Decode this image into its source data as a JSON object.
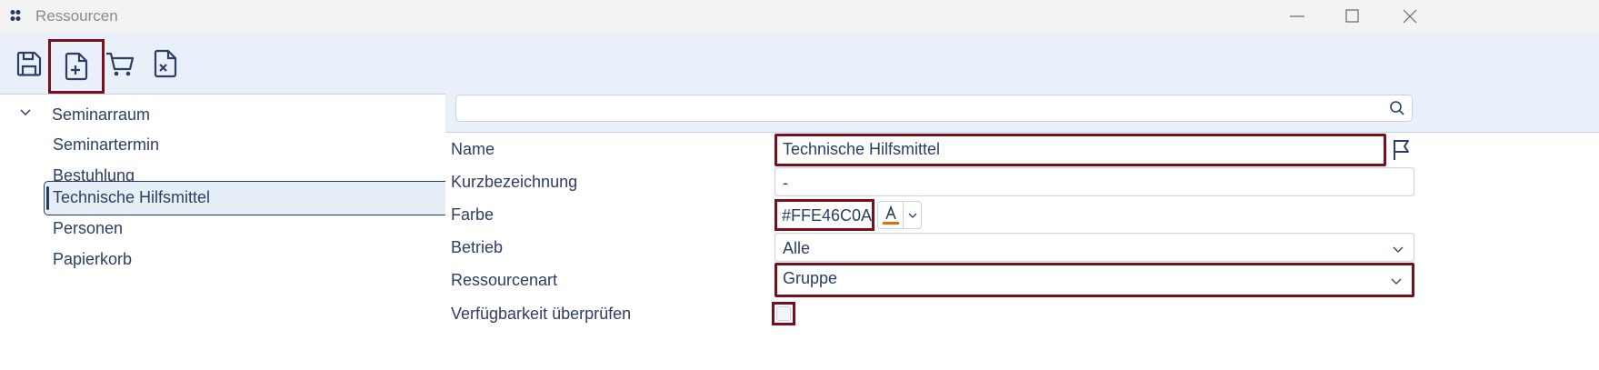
{
  "window": {
    "title": "Ressourcen"
  },
  "toolbar": {
    "items": [
      {
        "name": "save",
        "icon": "save-icon"
      },
      {
        "name": "new",
        "icon": "new-document-icon",
        "highlighted": true
      },
      {
        "name": "cart",
        "icon": "cart-icon"
      },
      {
        "name": "delete",
        "icon": "delete-document-icon"
      }
    ]
  },
  "tree": {
    "items": [
      {
        "label": "Seminarraum",
        "expanded": true
      },
      {
        "label": "Seminartermin"
      },
      {
        "label": "Bestuhlung"
      },
      {
        "label": "Technische Hilfsmittel",
        "selected": true
      },
      {
        "label": "Personen"
      },
      {
        "label": "Papierkorb"
      }
    ]
  },
  "search": {
    "value": ""
  },
  "form": {
    "name": {
      "label": "Name",
      "value": "Technische Hilfsmittel"
    },
    "kurz": {
      "label": "Kurzbezeichnung",
      "value": "-"
    },
    "farbe": {
      "label": "Farbe",
      "value": "#FFE46C0A",
      "swatch": "#e46c0a"
    },
    "betrieb": {
      "label": "Betrieb",
      "value": "Alle"
    },
    "ressourcenart": {
      "label": "Ressourcenart",
      "value": "Gruppe"
    },
    "verfuegbarkeit": {
      "label": "Verfügbarkeit überprüfen",
      "checked": false
    }
  },
  "colors": {
    "highlight": "#7a0f1c",
    "accent": "#2c3e63",
    "toolbar_bg": "#eaf0f9"
  }
}
